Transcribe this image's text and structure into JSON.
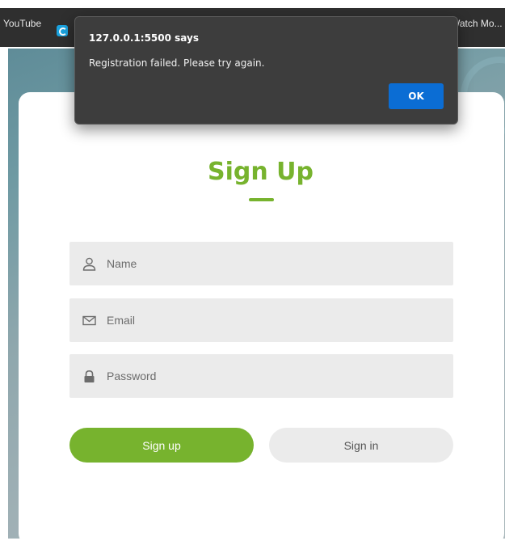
{
  "bookmarks": {
    "left_label": "YouTube",
    "right_label": "Watch Mo..."
  },
  "form": {
    "title": "Sign Up",
    "name_placeholder": "Name",
    "email_placeholder": "Email",
    "password_placeholder": "Password",
    "signup_label": "Sign up",
    "signin_label": "Sign in"
  },
  "alert": {
    "title": "127.0.0.1:5500 says",
    "message": "Registration failed. Please try again.",
    "ok_label": "OK"
  },
  "colors": {
    "accent": "#77b32e",
    "dialog_bg": "#3d3d3d",
    "ok_button": "#0b6dd4",
    "field_bg": "#ebebeb"
  },
  "icons": {
    "name": "user-icon",
    "email": "envelope-icon",
    "password": "lock-icon"
  }
}
